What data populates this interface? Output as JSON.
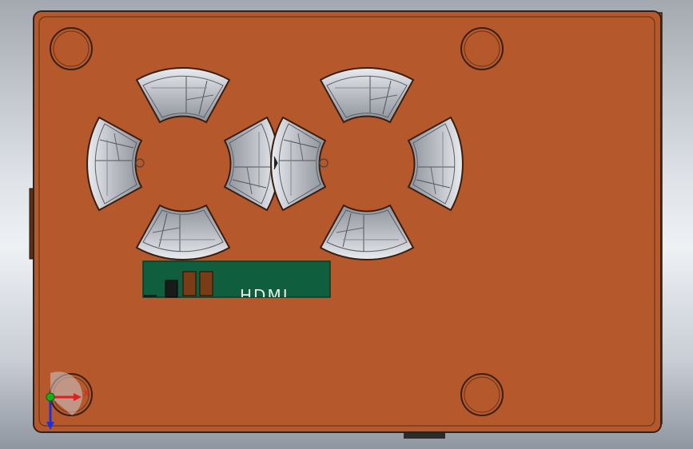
{
  "viewport": {
    "title": "",
    "pcb": {
      "label": "HDMI"
    },
    "triad": {
      "x_axis": "X"
    },
    "colors": {
      "body": "#b5582c",
      "edge": "#3a1f10",
      "pocket": "#b9bcc3",
      "pcb": "#0f5e3e",
      "axis_x": "#e01f1f",
      "axis_y": "#16b016",
      "axis_z": "#1f2fe0"
    }
  }
}
